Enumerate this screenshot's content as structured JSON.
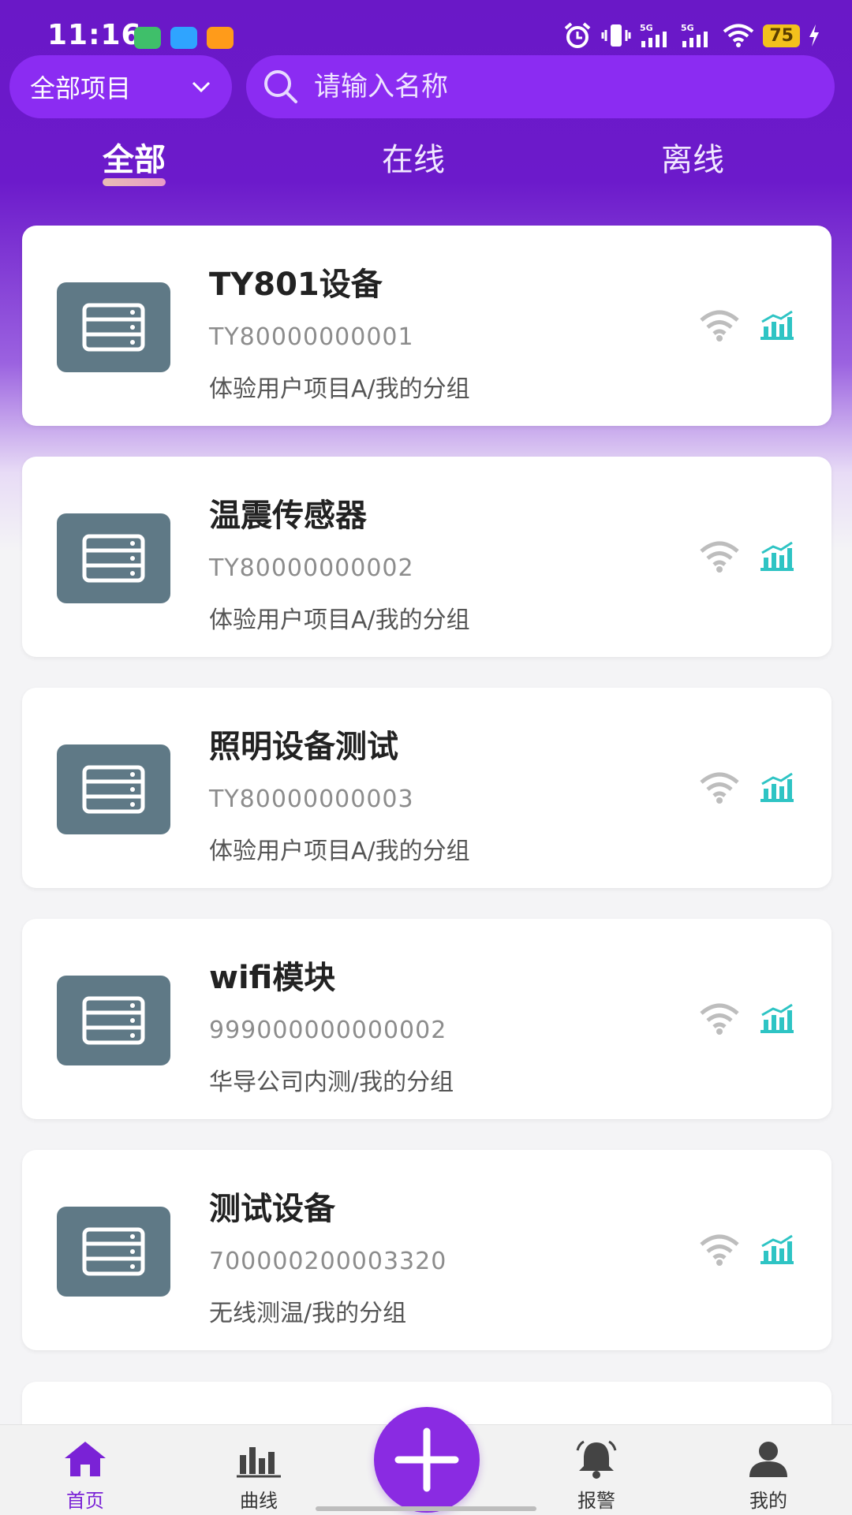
{
  "status_bar": {
    "time": "11:16",
    "battery": "75",
    "signal1": "5G",
    "signal2": "5G"
  },
  "header": {
    "project_select": "全部项目",
    "search_placeholder": "请输入名称"
  },
  "tabs": [
    {
      "label": "全部",
      "active": true
    },
    {
      "label": "在线",
      "active": false
    },
    {
      "label": "离线",
      "active": false
    }
  ],
  "devices": [
    {
      "name": "TY801设备",
      "sn": "TY80000000001",
      "group": "体验用户项目A/我的分组"
    },
    {
      "name": "温震传感器",
      "sn": "TY80000000002",
      "group": "体验用户项目A/我的分组"
    },
    {
      "name": "照明设备测试",
      "sn": "TY80000000003",
      "group": "体验用户项目A/我的分组"
    },
    {
      "name": "wifi模块",
      "sn": "999000000000002",
      "group": "华导公司内测/我的分组"
    },
    {
      "name": "测试设备",
      "sn": "700000200003320",
      "group": "无线测温/我的分组"
    }
  ],
  "bottom_nav": [
    {
      "label": "首页",
      "icon": "home-icon",
      "active": true
    },
    {
      "label": "曲线",
      "icon": "chart-icon",
      "active": false
    },
    {
      "label": "报警",
      "icon": "bell-icon",
      "active": false
    },
    {
      "label": "我的",
      "icon": "user-icon",
      "active": false
    }
  ],
  "colors": {
    "primary": "#6a18c7",
    "accent": "#8a2be2",
    "device_icon_bg": "#5f7986",
    "chart_teal": "#2ec4c4"
  }
}
